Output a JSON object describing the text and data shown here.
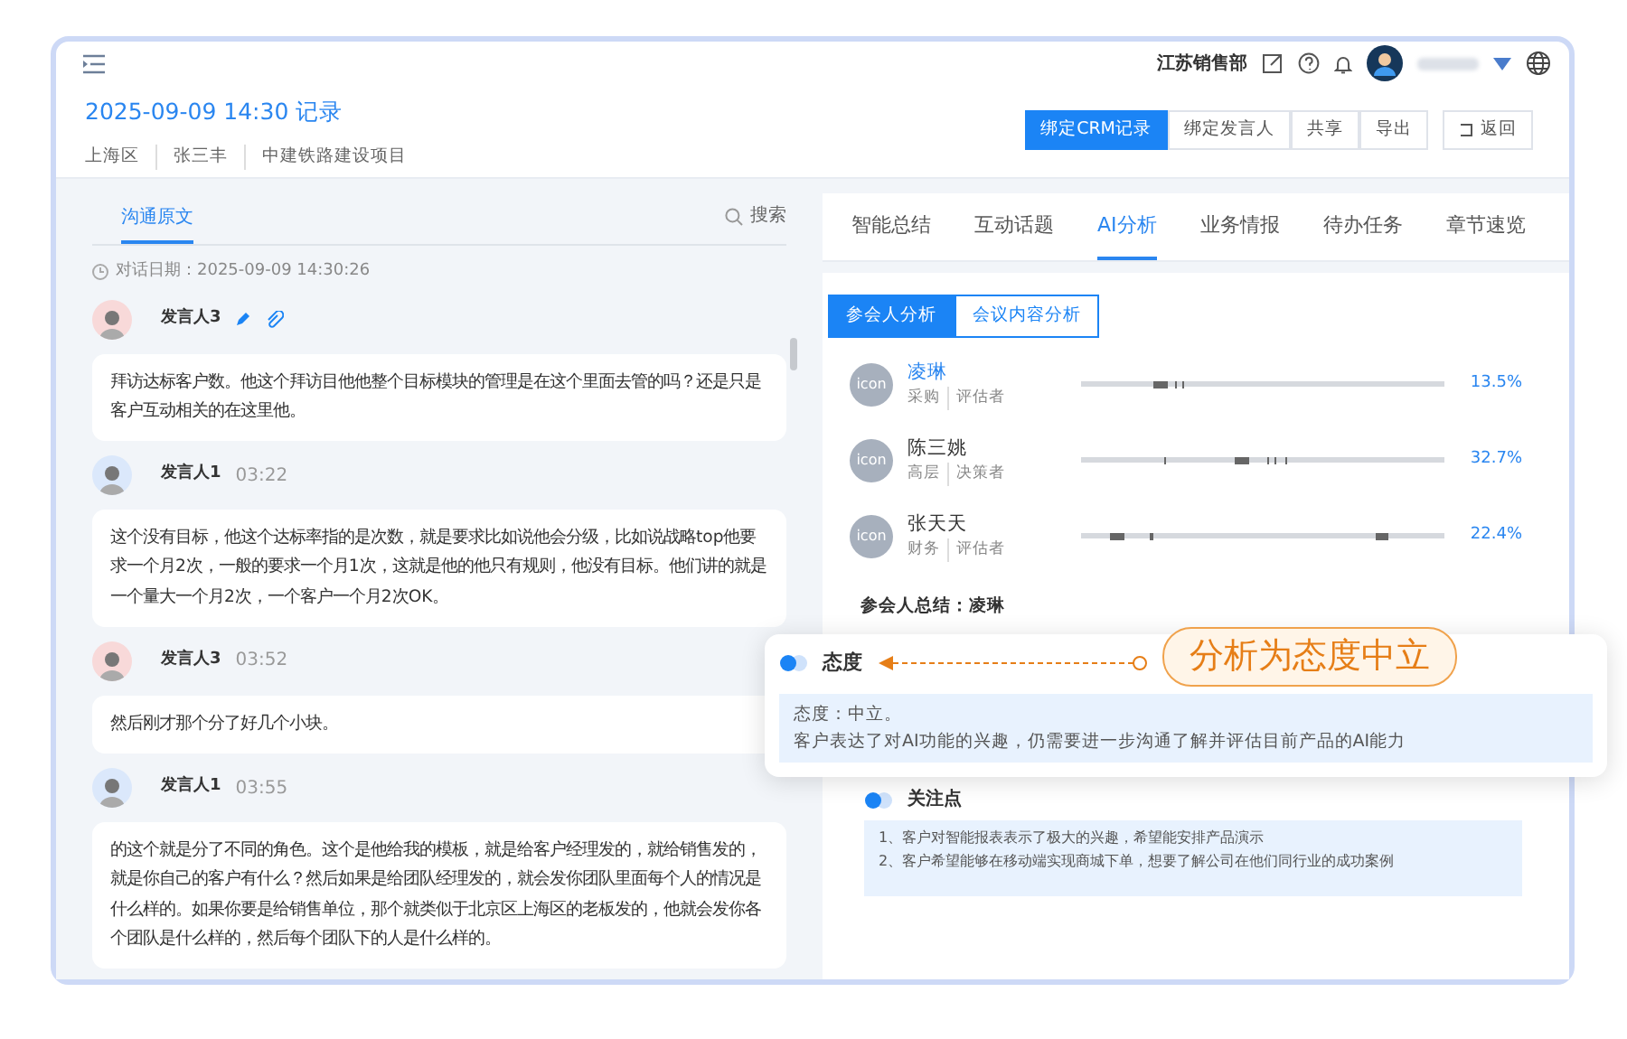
{
  "header": {
    "department": "江苏销售部"
  },
  "record": {
    "title": "2025-09-09 14:30 记录",
    "tags": [
      "上海区",
      "张三丰",
      "中建铁路建设项目"
    ]
  },
  "actions": [
    {
      "label": "绑定CRM记录",
      "primary": true
    },
    {
      "label": "绑定发言人",
      "primary": false
    },
    {
      "label": "共享",
      "primary": false
    },
    {
      "label": "导出",
      "primary": false
    }
  ],
  "back_button": "返回",
  "left_tabs": [
    {
      "label": "沟通原文",
      "selected": true
    }
  ],
  "search_label": "搜索",
  "conversation_date": "对话日期：2025-09-09 14:30:26",
  "messages": [
    {
      "speaker": "发言人3",
      "editable": true,
      "color": "#f8d9d9",
      "text": "拜访达标客户数。他这个拜访目他他整个目标模块的管理是在这个里面去管的吗？还是只是客户互动相关的在这里他。"
    },
    {
      "speaker": "发言人1",
      "time": "03:22",
      "editable": false,
      "color": "#dbe8fb",
      "text": "这个没有目标，他这个达标率指的是次数，就是要求比如说他会分级，比如说战略top他要求一个月2次，一般的要求一个月1次，这就是他的他只有规则，他没有目标。他们讲的就是一个量大一个月2次，一个客户一个月2次OK。"
    },
    {
      "speaker": "发言人3",
      "time": "03:52",
      "editable": false,
      "color": "#f8d9d9",
      "text": "然后刚才那个分了好几个小块。"
    },
    {
      "speaker": "发言人1",
      "time": "03:55",
      "editable": false,
      "color": "#dbe8fb",
      "text": "的这个就是分了不同的角色。这个是他给我的模板，就是给客户经理发的，就给销售发的，就是你自己的客户有什么？然后如果是给团队经理发的，就会发你团队里面每个人的情况是什么样的。如果你要是给销售单位，那个就类似于北京区上海区的老板发的，他就会发你各个团队是什么样的，然后每个团队下的人是什么样的。"
    }
  ],
  "right_tabs": [
    {
      "label": "智能总结",
      "selected": false
    },
    {
      "label": "互动话题",
      "selected": false
    },
    {
      "label": "AI分析",
      "selected": true
    },
    {
      "label": "业务情报",
      "selected": false
    },
    {
      "label": "待办任务",
      "selected": false
    },
    {
      "label": "章节速览",
      "selected": false
    }
  ],
  "sub_tabs": [
    {
      "label": "参会人分析",
      "selected": true
    },
    {
      "label": "会议内容分析",
      "selected": false
    }
  ],
  "participants": [
    {
      "avatar_label": "icon",
      "name": "凌琳",
      "selected": true,
      "tags": [
        "采购",
        "评估者"
      ],
      "share": "13.5%"
    },
    {
      "avatar_label": "icon",
      "name": "陈三姚",
      "selected": false,
      "tags": [
        "高层",
        "决策者"
      ],
      "share": "32.7%"
    },
    {
      "avatar_label": "icon",
      "name": "张天天",
      "selected": false,
      "tags": [
        "财务",
        "评估者"
      ],
      "share": "22.4%"
    }
  ],
  "summary_title": "参会人总结：凌琳",
  "popup": {
    "title": "态度",
    "lines": [
      "态度：中立。",
      "客户表达了对AI功能的兴趣，仍需要进一步沟通了解并评估目前产品的AI能力"
    ]
  },
  "callout": "分析为态度中立",
  "focus": {
    "title": "关注点",
    "lines": [
      "1、客户对智能报表表示了极大的兴趣，希望能安排产品演示",
      "2、客户希望能够在移动端实现商城下单，想要了解公司在他们同行业的成功案例"
    ]
  }
}
